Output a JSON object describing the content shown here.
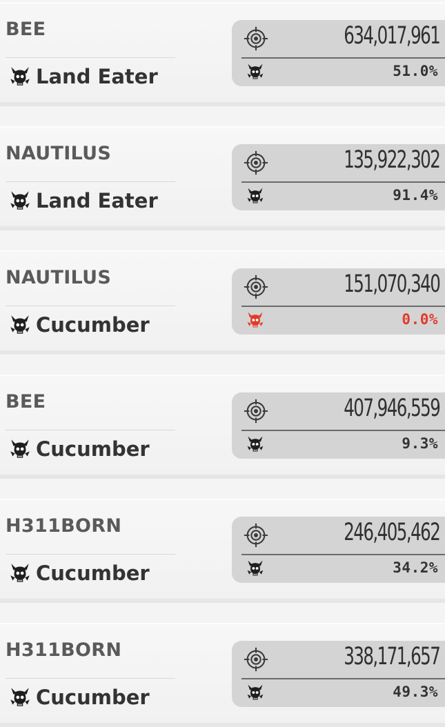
{
  "colors": {
    "text_dark": "#333333",
    "player_gray": "#5a5a5a",
    "stat_bg": "#d4d4d4",
    "alert_red": "#e23a2a"
  },
  "icons": {
    "target": "crosshair-target-icon",
    "boss": "horned-skull-icon"
  },
  "entries": [
    {
      "player": "BEE",
      "boss": "Land Eater",
      "damage": "634,017,961",
      "percent": "51.0%",
      "highlight": false
    },
    {
      "player": "NAUTILUS",
      "boss": "Land Eater",
      "damage": "135,922,302",
      "percent": "91.4%",
      "highlight": false
    },
    {
      "player": "NAUTILUS",
      "boss": "Cucumber",
      "damage": "151,070,340",
      "percent": "0.0%",
      "highlight": true
    },
    {
      "player": "BEE",
      "boss": "Cucumber",
      "damage": "407,946,559",
      "percent": "9.3%",
      "highlight": false
    },
    {
      "player": "H311BORN",
      "boss": "Cucumber",
      "damage": "246,405,462",
      "percent": "34.2%",
      "highlight": false
    },
    {
      "player": "H311BORN",
      "boss": "Cucumber",
      "damage": "338,171,657",
      "percent": "49.3%",
      "highlight": false
    }
  ]
}
